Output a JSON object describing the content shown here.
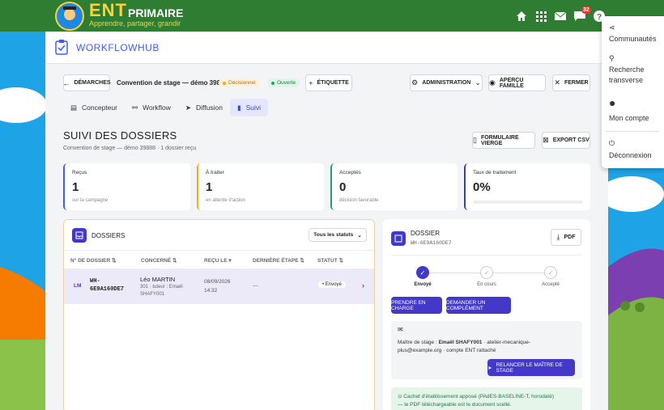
{
  "portal": {
    "logo_main": "ENT",
    "logo_sub": "PRIMAIRE",
    "tagline": "Apprendre, partager, grandir",
    "notif_count": "32"
  },
  "user_menu": {
    "items": [
      {
        "label": "Communautés",
        "icon": "share-icon"
      },
      {
        "label": "Recherche transverse",
        "icon": "search-icon"
      },
      {
        "label": "Mon compte",
        "icon": "user-icon"
      },
      {
        "label": "Déconnexion",
        "icon": "power-icon"
      }
    ]
  },
  "app": {
    "name": "WORKFLOWHUB"
  },
  "toolbar": {
    "back": "Démarches",
    "doc_title": "Convention de stage — démo 39888",
    "badge_decision": "Décisionnel",
    "badge_open": "Ouverte",
    "label_btn": "Étiquette",
    "admin": "Administration",
    "preview": "Aperçu famille",
    "close": "Fermer"
  },
  "tabs": [
    "Concepteur",
    "Workflow",
    "Diffusion",
    "Suivi"
  ],
  "page": {
    "title": "SUIVI DES DOSSIERS",
    "subtitle": "Convention de stage — démo 39888 · 1 dossier reçu",
    "btn_form": "Formulaire vierge",
    "btn_export": "Export CSV"
  },
  "stats": [
    {
      "label": "Reçus",
      "value": "1",
      "sub": "sur la campagne",
      "color": "#3d5afe"
    },
    {
      "label": "À traiter",
      "value": "1",
      "sub": "en attente d'action",
      "color": "#f5a623"
    },
    {
      "label": "Acceptés",
      "value": "0",
      "sub": "décision favorable",
      "color": "#22a06b"
    },
    {
      "label": "Taux de traitement",
      "value": "0%",
      "sub": "",
      "color": "#4338ca",
      "progress": 0
    }
  ],
  "list": {
    "title": "DOSSIERS",
    "status_filter": "Tous les statuts",
    "columns": [
      "N° DE DOSSIER",
      "CONCERNÉ",
      "REÇU LE",
      "DERNIÈRE ÉTAPE",
      "STATUT"
    ],
    "rows": [
      {
        "initials": "LM",
        "id1": "WH-",
        "id2": "6E9A160DE7",
        "name": "Léo MARTIN",
        "meta1": "301 · tuteur : Emaël",
        "meta2": "SHAFY001",
        "date1": "08/09/2026",
        "date2": "14:32",
        "last_step": "—",
        "status": "Envoyé"
      }
    ]
  },
  "detail": {
    "title": "DOSSIER",
    "id": "WH-6E9A160DE7",
    "pdf": "PDF",
    "steps": [
      "Envoyé",
      "En cours",
      "Accepté"
    ],
    "btn_take": "Prendre en charge",
    "btn_complement": "Demander un complément",
    "msg_prefix": "Maître de stage : ",
    "msg_name": "Emaël SHAFY001",
    "msg_rest": " · atelier-mecanique-",
    "msg_line2": "plus@example.org · compte ENT rattaché",
    "btn_remind": "Relancer le maître de stage",
    "seal_line1": "Cachet d'établissement apposé (PAdES-BASELINE-T, horodaté)",
    "seal_line2": "— le PDF téléchargeable est le document scellé."
  }
}
